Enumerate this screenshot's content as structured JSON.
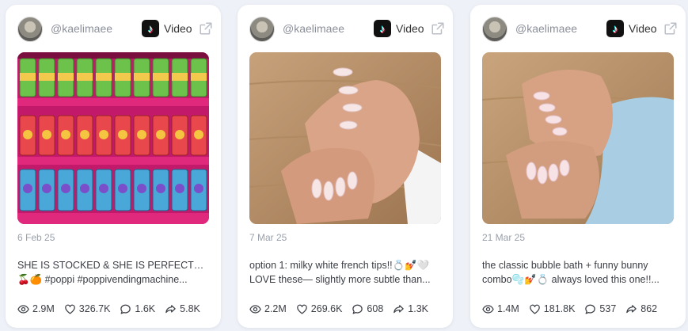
{
  "posts": [
    {
      "handle": "@kaelimaee",
      "type_label": "Video",
      "platform_icon": "tiktok-icon",
      "date": "6 Feb 25",
      "caption_line1": "SHE IS STOCKED & SHE IS PERFECT🥵🥤🍋",
      "caption_line2": "🍒🍊 #poppi #poppivendingmachine...",
      "views": "2.9M",
      "likes": "326.7K",
      "comments": "1.6K",
      "shares": "5.8K"
    },
    {
      "handle": "@kaelimaee",
      "type_label": "Video",
      "platform_icon": "tiktok-icon",
      "date": "7 Mar 25",
      "caption_line1": "option 1: milky white french tips!!💍💅🤍",
      "caption_line2": "LOVE these— slightly more subtle than...",
      "views": "2.2M",
      "likes": "269.6K",
      "comments": "608",
      "shares": "1.3K"
    },
    {
      "handle": "@kaelimaee",
      "type_label": "Video",
      "platform_icon": "tiktok-icon",
      "date": "21 Mar 25",
      "caption_line1": "the classic bubble bath + funny bunny",
      "caption_line2": "combo🫧💅💍 always loved this one!!...",
      "views": "1.4M",
      "likes": "181.8K",
      "comments": "537",
      "shares": "862"
    }
  ]
}
